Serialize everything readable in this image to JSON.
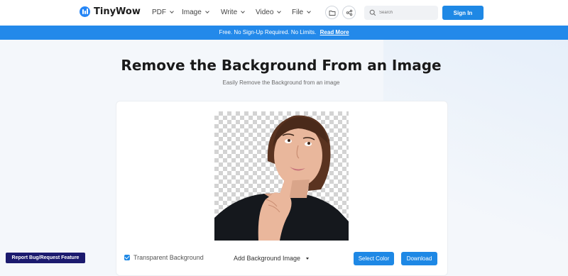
{
  "brand": {
    "name": "TinyWow",
    "accent": "#2686f6"
  },
  "nav": {
    "items": [
      {
        "label": "PDF"
      },
      {
        "label": "Image"
      },
      {
        "label": "Write"
      },
      {
        "label": "Video"
      },
      {
        "label": "File"
      }
    ],
    "icons": [
      "folder-icon",
      "share-icon"
    ],
    "search_placeholder": "Search",
    "signin_label": "Sign In"
  },
  "banner": {
    "text": "Free. No Sign-Up Required. No Limits.",
    "link_label": "Read More",
    "color": "#2389ea"
  },
  "main": {
    "title": "Remove the Background From an Image",
    "subtitle": "Easily Remove the Background from an image"
  },
  "controls": {
    "transparent_label": "Transparent Background",
    "transparent_checked": true,
    "add_bg_label": "Add Background Image",
    "select_color_label": "Select Color",
    "download_label": "Download"
  },
  "report_label": "Report Bug/Request Feature"
}
